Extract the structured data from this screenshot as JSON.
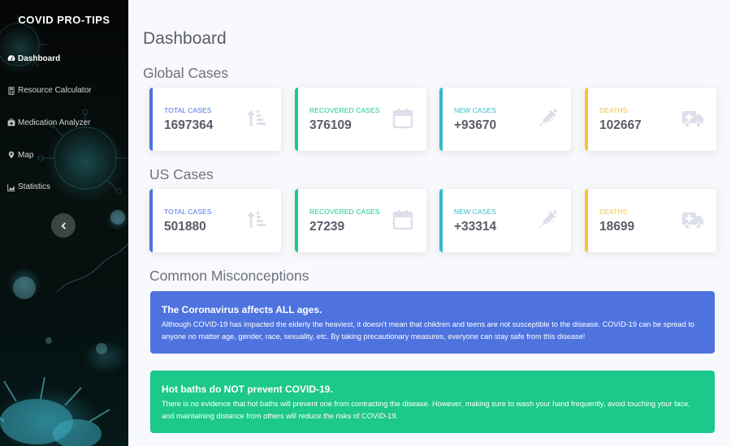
{
  "sidebar": {
    "brand": "COVID PRO-TIPS",
    "items": [
      {
        "label": "Dashboard",
        "icon": "tachometer-icon",
        "active": true
      },
      {
        "label": "Resource Calculator",
        "icon": "calculator-icon",
        "active": false
      },
      {
        "label": "Medication Analyzer",
        "icon": "medkit-icon",
        "active": false
      },
      {
        "label": "Map",
        "icon": "map-marker-icon",
        "active": false
      },
      {
        "label": "Statistics",
        "icon": "chart-area-icon",
        "active": false
      }
    ],
    "collapse_icon": "chevron-left-icon"
  },
  "main": {
    "title": "Dashboard",
    "global": {
      "title": "Global Cases",
      "cards": [
        {
          "label": "TOTAL CASES",
          "value": "1697364",
          "icon": "sort-amount-up-icon",
          "color": "#4e73df"
        },
        {
          "label": "RECOVERED CASES",
          "value": "376109",
          "icon": "calendar-icon",
          "color": "#1cc88a"
        },
        {
          "label": "NEW CASES",
          "value": "+93670",
          "icon": "syringe-icon",
          "color": "#36b9cc"
        },
        {
          "label": "DEATHS",
          "value": "102667",
          "icon": "ambulance-icon",
          "color": "#f6c23e"
        }
      ]
    },
    "us": {
      "title": "US Cases",
      "cards": [
        {
          "label": "TOTAL CASES",
          "value": "501880",
          "icon": "sort-amount-up-icon",
          "color": "#4e73df"
        },
        {
          "label": "RECOVERED CASES",
          "value": "27239",
          "icon": "calendar-icon",
          "color": "#1cc88a"
        },
        {
          "label": "NEW CASES",
          "value": "+33314",
          "icon": "syringe-icon",
          "color": "#36b9cc"
        },
        {
          "label": "DEATHS",
          "value": "18699",
          "icon": "ambulance-icon",
          "color": "#f6c23e"
        }
      ]
    },
    "misconceptions": {
      "title": "Common Misconceptions",
      "items": [
        {
          "title": "The Coronavirus affects ALL ages.",
          "body": "Although COVID-19 has impacted the elderly the heaviest, it doesn't mean that children and teens are not susceptible to the disease. COVID-19 can be spread to anyone no matter age, gender, race, sexuality, etc. By taking precautionary measures, everyone can stay safe from this disease!",
          "color": "#4e73df"
        },
        {
          "title": "Hot baths do NOT prevent COVID-19.",
          "body": "There is no evidence that hot baths will prevent one from contracting the disease. However, making sure to wash your hand frequently, avoid touching your face, and maintaining distance from others will reduce the risks of COVID-19.",
          "color": "#1cc88a"
        }
      ]
    }
  }
}
